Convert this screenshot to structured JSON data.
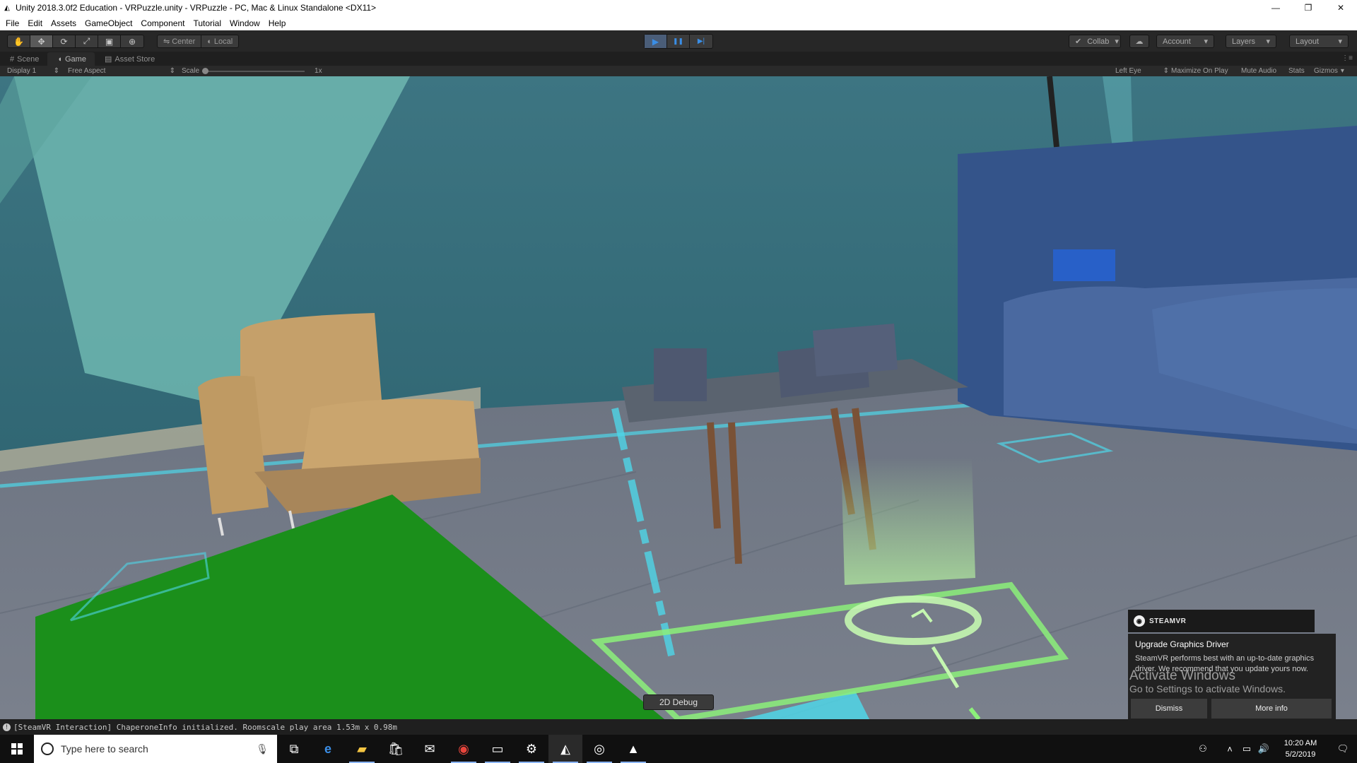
{
  "window": {
    "title": "Unity 2018.3.0f2 Education - VRPuzzle.unity - VRPuzzle - PC, Mac & Linux Standalone <DX11>",
    "minimize": "—",
    "maximize": "❐",
    "close": "✕"
  },
  "menu": [
    "File",
    "Edit",
    "Assets",
    "GameObject",
    "Component",
    "Tutorial",
    "Window",
    "Help"
  ],
  "toolbar": {
    "tools": [
      "✋",
      "✥",
      "⟳",
      "⤢",
      "▣",
      "⊕"
    ],
    "pivot": "Center",
    "space": "Local",
    "play": "▶",
    "pause": "❚❚",
    "step": "▶|",
    "collab": "Collab",
    "cloud": "☁",
    "account": "Account",
    "layers": "Layers",
    "layout": "Layout"
  },
  "tabs": {
    "scene": "Scene",
    "game": "Game",
    "asset_store": "Asset Store"
  },
  "game_view": {
    "display": "Display 1",
    "aspect": "Free Aspect",
    "scale_label": "Scale",
    "scale_value": "1x",
    "scale_fraction": 0.0,
    "left_eye": "Left Eye",
    "maximize_on_play": "Maximize On Play",
    "mute_audio": "Mute Audio",
    "stats": "Stats",
    "gizmos": "Gizmos"
  },
  "viewport": {
    "debug_button": "2D Debug"
  },
  "steamvr": {
    "brand": "STEAMVR",
    "title": "Upgrade Graphics Driver",
    "message": "SteamVR performs best with an up-to-date graphics driver. We recommend that you update yours now.",
    "dismiss": "Dismiss",
    "more_info": "More info"
  },
  "activation": {
    "line1": "Activate Windows",
    "line2": "Go to Settings to activate Windows."
  },
  "status": {
    "message": "[SteamVR Interaction] ChaperoneInfo initialized. Roomscale play area 1.53m x 0.98m"
  },
  "taskbar": {
    "search_placeholder": "Type here to search",
    "time": "10:20 AM",
    "date": "5/2/2019"
  }
}
